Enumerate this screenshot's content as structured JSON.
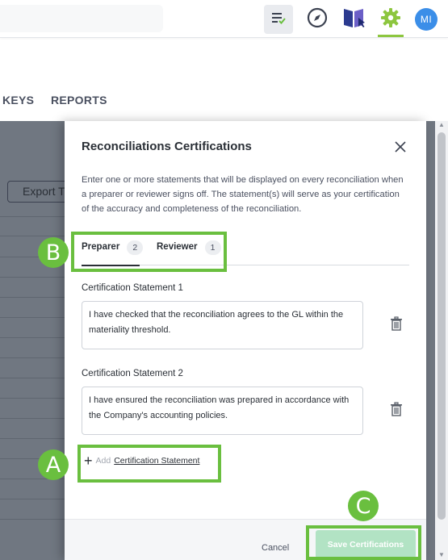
{
  "topbar": {
    "avatar_initials": "MI",
    "icons": [
      "tasks-check-icon",
      "compass-icon",
      "book-icon",
      "gear-icon"
    ],
    "accent_color": "#8dc63f"
  },
  "nav": {
    "items": [
      {
        "label": "KEYS"
      },
      {
        "label": "REPORTS"
      }
    ]
  },
  "background": {
    "export_button_label": "Export T"
  },
  "modal": {
    "title": "Reconciliations Certifications",
    "description": "Enter one or more statements that will be displayed on every reconciliation when a preparer or reviewer signs off. The statement(s) will serve as your certification of the accuracy and completeness of the reconciliation.",
    "tabs": [
      {
        "label": "Preparer",
        "count": "2",
        "active": true
      },
      {
        "label": "Reviewer",
        "count": "1",
        "active": false
      }
    ],
    "statements": [
      {
        "label": "Certification Statement 1",
        "text": "I have checked that the reconciliation agrees to the GL within the materiality threshold."
      },
      {
        "label": "Certification Statement 2",
        "text": "I have ensured the reconciliation was prepared in accordance with the Company's accounting policies."
      }
    ],
    "add_link": {
      "prefix": "Add",
      "target": "Certification Statement"
    },
    "footer": {
      "cancel_label": "Cancel",
      "save_label": "Save Certifications"
    }
  },
  "callouts": {
    "a": "A",
    "b": "B",
    "c": "C",
    "color": "#6abf3f"
  }
}
